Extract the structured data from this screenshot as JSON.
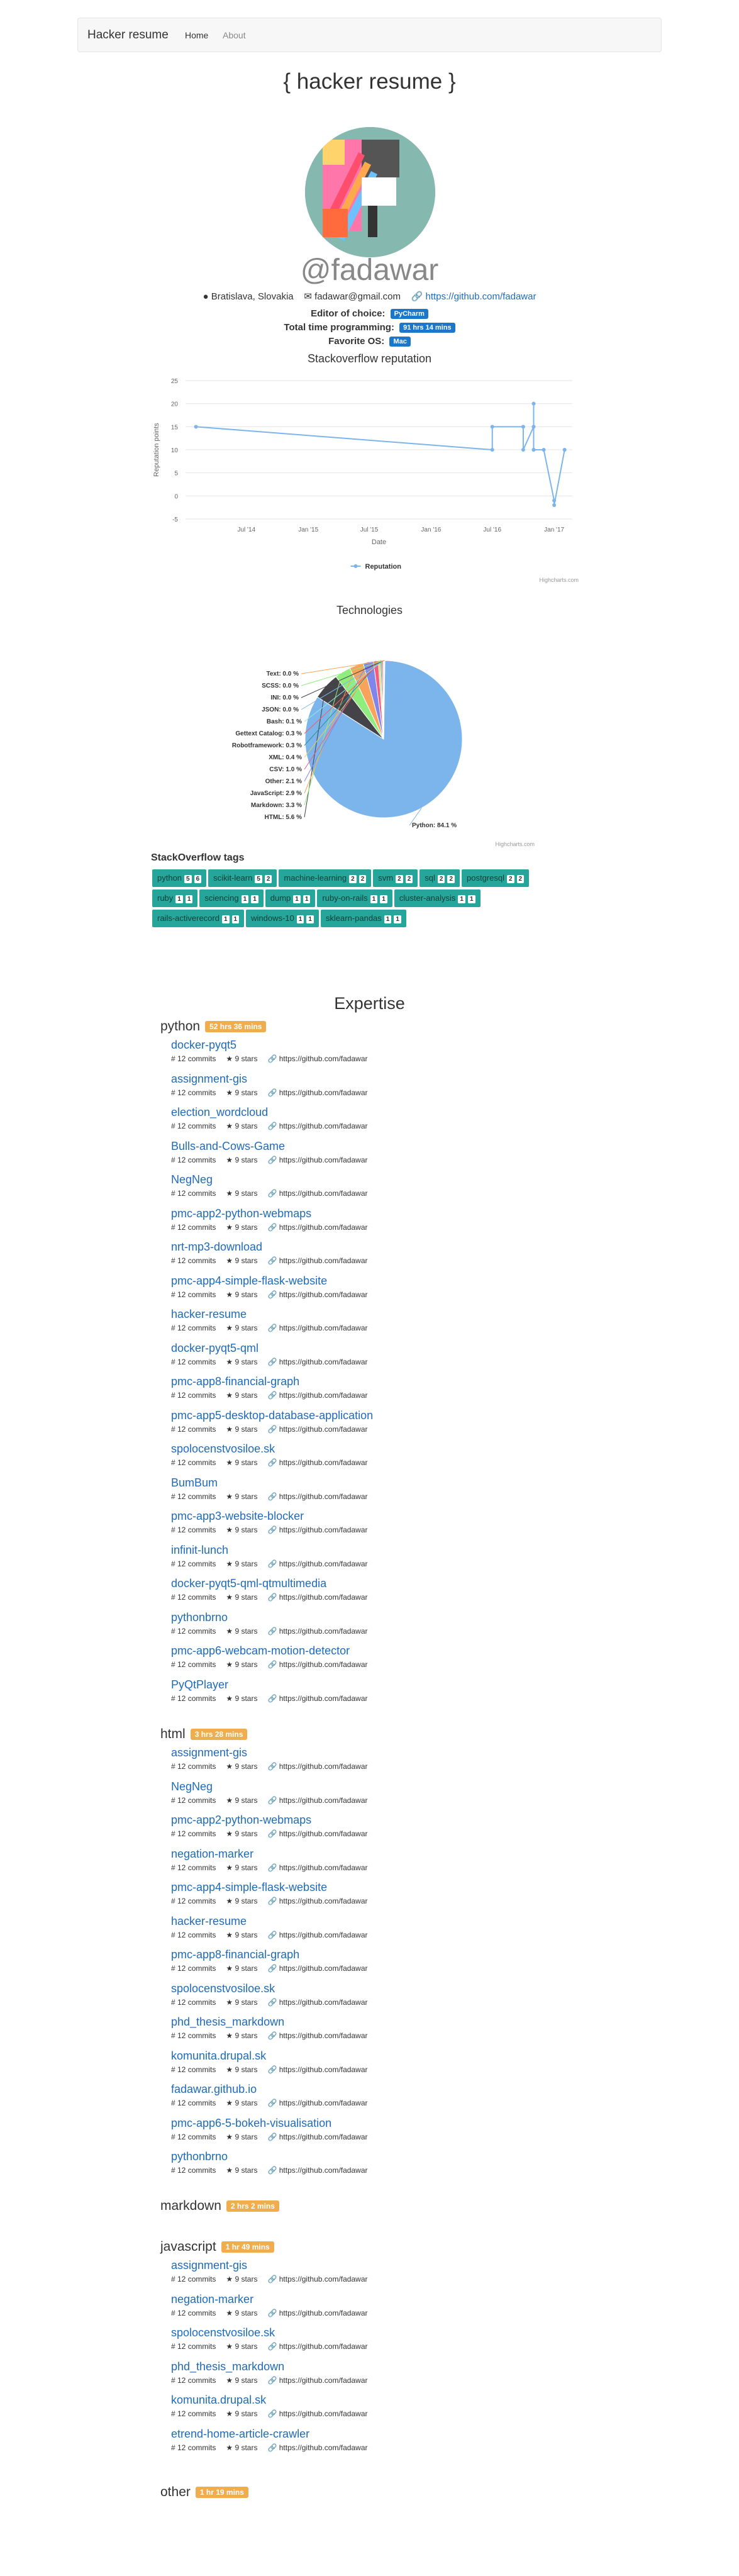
{
  "nav": {
    "brand": "Hacker resume",
    "home": "Home",
    "about": "About"
  },
  "page_title": "{ hacker resume }",
  "profile": {
    "handle": "@fadawar",
    "location": "Bratislava, Slovakia",
    "email": "fadawar@gmail.com",
    "github": "https://github.com/fadawar",
    "editor_label": "Editor of choice:",
    "editor": "PyCharm",
    "time_label": "Total time programming:",
    "time": "91 hrs 14 mins",
    "os_label": "Favorite OS:",
    "os": "Mac"
  },
  "chart_data": [
    {
      "type": "line",
      "title": "Stackoverflow reputation",
      "xlabel": "Date",
      "ylabel": "Reputation points",
      "yticks": [
        -5,
        0,
        5,
        10,
        15,
        20,
        25
      ],
      "ylim": [
        -5,
        25
      ],
      "xticks": [
        "Jul '14",
        "Jan '15",
        "Jul '15",
        "Jan '16",
        "Jul '16",
        "Jan '17"
      ],
      "series": [
        {
          "name": "Reputation",
          "color": "#7cb5ec",
          "x": [
            "2014-02",
            "2016-07",
            "2016-07",
            "2016-10",
            "2016-10",
            "2016-11",
            "2016-11",
            "2016-11",
            "2016-11",
            "2016-11",
            "2016-12",
            "2017-01",
            "2017-01",
            "2017-02"
          ],
          "values": [
            15,
            10,
            15,
            15,
            10,
            15,
            20,
            10,
            15,
            10,
            10,
            -1,
            -2,
            10
          ]
        }
      ],
      "credit": "Highcharts.com"
    },
    {
      "type": "pie",
      "title": "Technologies",
      "slices": [
        {
          "label": "Python: 84.1 %",
          "value": 84.1,
          "color": "#7cb5ec"
        },
        {
          "label": "HTML: 5.6 %",
          "value": 5.6,
          "color": "#434348"
        },
        {
          "label": "Markdown: 3.3 %",
          "value": 3.3,
          "color": "#90ed7d"
        },
        {
          "label": "JavaScript: 2.9 %",
          "value": 2.9,
          "color": "#f7a35c"
        },
        {
          "label": "Other: 2.1 %",
          "value": 2.1,
          "color": "#8085e9"
        },
        {
          "label": "CSV: 1.0 %",
          "value": 1.0,
          "color": "#f15c80"
        },
        {
          "label": "XML: 0.4 %",
          "value": 0.4,
          "color": "#e4d354"
        },
        {
          "label": "Robotframework: 0.3 %",
          "value": 0.3,
          "color": "#2b908f"
        },
        {
          "label": "Gettext Catalog: 0.3 %",
          "value": 0.3,
          "color": "#f45b5b"
        },
        {
          "label": "Bash: 0.1 %",
          "value": 0.1,
          "color": "#91e8e1"
        },
        {
          "label": "JSON: 0.0 %",
          "value": 0.0,
          "color": "#7cb5ec"
        },
        {
          "label": "INI: 0.0 %",
          "value": 0.0,
          "color": "#434348"
        },
        {
          "label": "SCSS: 0.0 %",
          "value": 0.0,
          "color": "#90ed7d"
        },
        {
          "label": "Text: 0.0 %",
          "value": 0.0,
          "color": "#f7a35c"
        }
      ],
      "credit": "Highcharts.com"
    }
  ],
  "so_tags": {
    "title": "StackOverflow tags",
    "items": [
      {
        "name": "python",
        "a": "5",
        "b": "6"
      },
      {
        "name": "scikit-learn",
        "a": "5",
        "b": "2"
      },
      {
        "name": "machine-learning",
        "a": "2",
        "b": "2"
      },
      {
        "name": "svm",
        "a": "2",
        "b": "2"
      },
      {
        "name": "sql",
        "a": "2",
        "b": "2"
      },
      {
        "name": "postgresql",
        "a": "2",
        "b": "2"
      },
      {
        "name": "ruby",
        "a": "1",
        "b": "1"
      },
      {
        "name": "sciencing",
        "a": "1",
        "b": "1"
      },
      {
        "name": "dump",
        "a": "1",
        "b": "1"
      },
      {
        "name": "ruby-on-rails",
        "a": "1",
        "b": "1"
      },
      {
        "name": "cluster-analysis",
        "a": "1",
        "b": "1"
      },
      {
        "name": "rails-activerecord",
        "a": "1",
        "b": "1"
      },
      {
        "name": "windows-10",
        "a": "1",
        "b": "1"
      },
      {
        "name": "sklearn-pandas",
        "a": "1",
        "b": "1"
      }
    ]
  },
  "expertise": {
    "title": "Expertise",
    "meta": {
      "commits": "12 commits",
      "stars": "9 stars",
      "url": "https://github.com/fadawar"
    },
    "sections": [
      {
        "lang": "python",
        "time": "52 hrs 36 mins",
        "projects": [
          "docker-pyqt5",
          "assignment-gis",
          "election_wordcloud",
          "Bulls-and-Cows-Game",
          "NegNeg",
          "pmc-app2-python-webmaps",
          "nrt-mp3-download",
          "pmc-app4-simple-flask-website",
          "hacker-resume",
          "docker-pyqt5-qml",
          "pmc-app8-financial-graph",
          "pmc-app5-desktop-database-application",
          "spolocenstvosiloe.sk",
          "BumBum",
          "pmc-app3-website-blocker",
          "infinit-lunch",
          "docker-pyqt5-qml-qtmultimedia",
          "pythonbrno",
          "pmc-app6-webcam-motion-detector",
          "PyQtPlayer"
        ]
      },
      {
        "lang": "html",
        "time": "3 hrs 28 mins",
        "projects": [
          "assignment-gis",
          "NegNeg",
          "pmc-app2-python-webmaps",
          "negation-marker",
          "pmc-app4-simple-flask-website",
          "hacker-resume",
          "pmc-app8-financial-graph",
          "spolocenstvosiloe.sk",
          "phd_thesis_markdown",
          "komunita.drupal.sk",
          "fadawar.github.io",
          "pmc-app6-5-bokeh-visualisation",
          "pythonbrno"
        ]
      },
      {
        "lang": "markdown",
        "time": "2 hrs 2 mins",
        "projects": []
      },
      {
        "lang": "javascript",
        "time": "1 hr 49 mins",
        "projects": [
          "assignment-gis",
          "negation-marker",
          "spolocenstvosiloe.sk",
          "phd_thesis_markdown",
          "komunita.drupal.sk",
          "etrend-home-article-crawler"
        ]
      },
      {
        "lang": "other",
        "time": "1 hr 19 mins",
        "projects": []
      }
    ]
  }
}
